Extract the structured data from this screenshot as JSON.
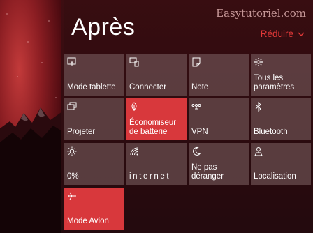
{
  "header": {
    "title": "Après",
    "watermark": "Easytutoriel.com",
    "collapse_label": "Réduire"
  },
  "tiles": [
    {
      "label": "Mode tablette",
      "icon": "tablet-mode-icon",
      "active": false
    },
    {
      "label": "Connecter",
      "icon": "connect-icon",
      "active": false
    },
    {
      "label": "Note",
      "icon": "note-icon",
      "active": false
    },
    {
      "label": "Tous les paramètres",
      "icon": "gear-icon",
      "active": false
    },
    {
      "label": "Projeter",
      "icon": "project-icon",
      "active": false
    },
    {
      "label": "Économiseur de batterie",
      "icon": "battery-saver-icon",
      "active": true
    },
    {
      "label": "VPN",
      "icon": "vpn-icon",
      "active": false
    },
    {
      "label": "Bluetooth",
      "icon": "bluetooth-icon",
      "active": false
    },
    {
      "label": "0%",
      "icon": "brightness-icon",
      "active": false
    },
    {
      "label": "internet",
      "icon": "wifi-icon",
      "active": false
    },
    {
      "label": "Ne pas déranger",
      "icon": "quiet-hours-icon",
      "active": false
    },
    {
      "label": "Localisation",
      "icon": "location-icon",
      "active": false
    },
    {
      "label": "Mode Avion",
      "icon": "airplane-icon",
      "active": true
    }
  ],
  "colors": {
    "accent": "#e23838",
    "active_tile": "#d8383c",
    "tile": "#76595c"
  }
}
